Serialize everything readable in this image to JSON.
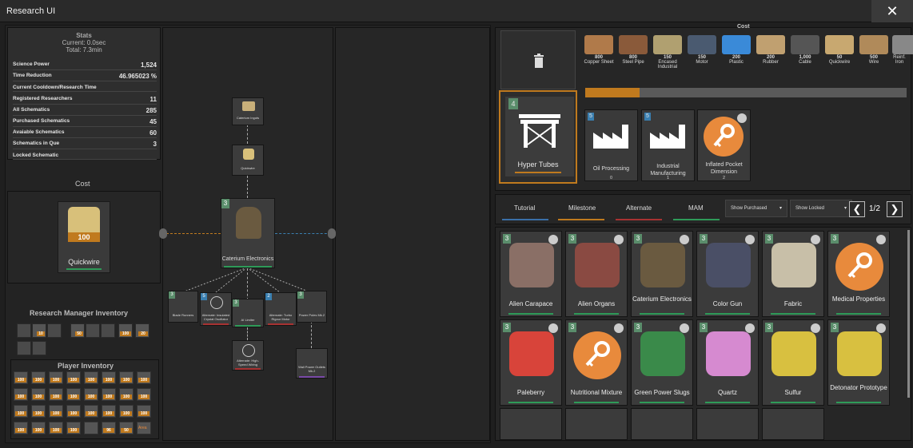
{
  "window": {
    "title": "Research UI",
    "close_label": "✕"
  },
  "stats": {
    "heading": "Stats",
    "current": "Current: 0.0sec",
    "total": "Total: 7.3min",
    "rows": [
      {
        "label": "Science Power",
        "value": "1,524"
      },
      {
        "label": "Time Reduction",
        "value": "46.965023 %"
      },
      {
        "label": "Current Cooldown/Research Time",
        "value": ""
      },
      {
        "label": "Registered Researchers",
        "value": "11"
      },
      {
        "label": "All Schematics",
        "value": "285"
      },
      {
        "label": "Purchased Schematics",
        "value": "45"
      },
      {
        "label": "Avaiable Schematics",
        "value": "60"
      },
      {
        "label": "Schematics in Que",
        "value": "3"
      },
      {
        "label": "Locked Schematic",
        "value": ""
      }
    ]
  },
  "cost_left": {
    "title": "Cost",
    "item_name": "Quickwire",
    "qty": "100"
  },
  "research_inventory": {
    "title": "Research Manager Inventory",
    "qtys": [
      "10",
      "50",
      "100",
      "20"
    ]
  },
  "player_inventory": {
    "title": "Player Inventory",
    "qty": "100",
    "q96": "96",
    "q50": "50",
    "area": "Area"
  },
  "tree": {
    "nodes": {
      "ingots": "Caterium Ingots",
      "quickwire": "Quickwire",
      "electronics": "Caterium Electronics",
      "blade": "Blade Runners",
      "crystal": "Alternate: Insulated Crystal Oscillator",
      "ailimiter": "AI Limiter",
      "rigour": "Alternate: Turbo Rigour Motor",
      "pole": "Power Poles Mk.2",
      "wiring": "Alternate: High-Speed Wiring",
      "outlet": "Wall Power Outlets Mk.2"
    },
    "tiers": {
      "main": "3",
      "blue": "5",
      "blue2": "2",
      "small": "3"
    }
  },
  "cost_right": {
    "title": "Cost",
    "items": [
      {
        "name": "Copper Sheet",
        "qty": "800"
      },
      {
        "name": "Steel Pipe",
        "qty": "800"
      },
      {
        "name": "Encased Industrial",
        "qty": "150"
      },
      {
        "name": "Motor",
        "qty": "150"
      },
      {
        "name": "Plastic",
        "qty": "200"
      },
      {
        "name": "Rubber",
        "qty": "200"
      },
      {
        "name": "Cable",
        "qty": "1,000"
      },
      {
        "name": "Quickwire",
        "qty": "50"
      },
      {
        "name": "Wire",
        "qty": "500"
      },
      {
        "name": "Reinf. Iron",
        "qty": ""
      }
    ],
    "progress": 0.17
  },
  "selected": {
    "name": "Hyper Tubes",
    "tier": "4"
  },
  "unlocks": [
    {
      "name": "Oil Processing",
      "count": "0",
      "tier": "5"
    },
    {
      "name": "Industrial Manufacturing",
      "count": "1",
      "tier": "5"
    },
    {
      "name": "Inflated Pocket Dimension",
      "count": "2",
      "tier": ""
    }
  ],
  "tabs": [
    {
      "label": "Tutorial",
      "color": "#3a6fa8"
    },
    {
      "label": "Milestone",
      "color": "#c07a1e"
    },
    {
      "label": "Alternate",
      "color": "#a83232"
    },
    {
      "label": "MAM",
      "color": "#2e9a58"
    }
  ],
  "filters": {
    "purchased": "Show Purchased",
    "locked": "Show Locked",
    "caret": "▾"
  },
  "pagination": {
    "prev": "❮",
    "next": "❯",
    "page": "1/2"
  },
  "cards": [
    {
      "name": "Alien Carapace",
      "tier": "3"
    },
    {
      "name": "Alien Organs",
      "tier": "3"
    },
    {
      "name": "Caterium Electronics",
      "tier": "3"
    },
    {
      "name": "Color Gun",
      "tier": "3"
    },
    {
      "name": "Fabric",
      "tier": "3"
    },
    {
      "name": "Medical Properties",
      "tier": "3"
    },
    {
      "name": "Paleberry",
      "tier": "3"
    },
    {
      "name": "Nutritional Mixture",
      "tier": "3"
    },
    {
      "name": "Green Power Slugs",
      "tier": "3"
    },
    {
      "name": "Quartz",
      "tier": "3"
    },
    {
      "name": "Sulfur",
      "tier": "3"
    },
    {
      "name": "Detonator Prototype",
      "tier": "3"
    }
  ],
  "colors": {
    "accent": "#c07a1e",
    "mam": "#2e9a58",
    "tier": "#5a8d6b",
    "blue_tier": "#3a7fb0"
  }
}
